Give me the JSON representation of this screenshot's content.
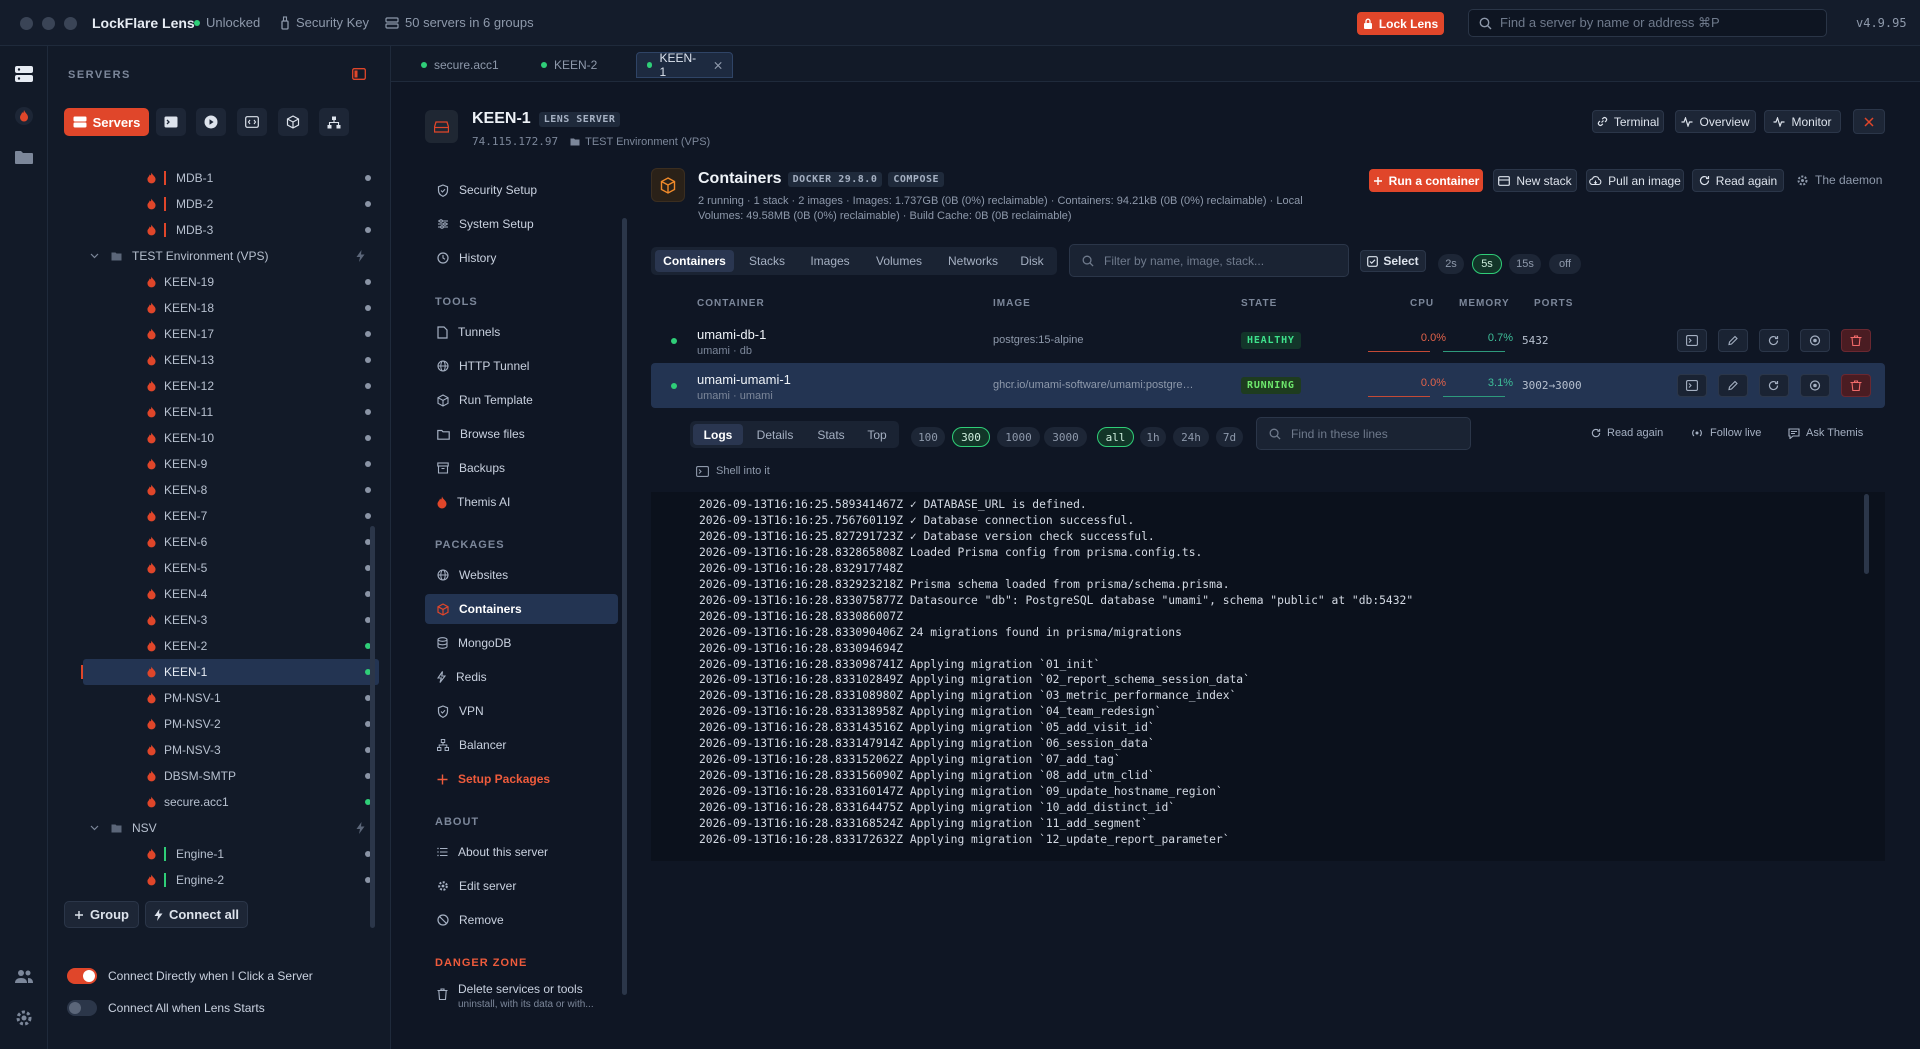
{
  "titlebar": {
    "app_title": "LockFlare Lens",
    "lock_status": "Unlocked",
    "security_key": "Security Key",
    "server_count": "50 servers in 6 groups",
    "lock_button": "Lock Lens",
    "search_placeholder": "Find a server by name or address ⌘P",
    "version": "v4.9.95"
  },
  "sidebar": {
    "heading": "SERVERS",
    "servers_tab": "Servers",
    "servers": [
      {
        "name": "MDB-1",
        "bar": "#e0462a",
        "online": false
      },
      {
        "name": "MDB-2",
        "bar": "#e0462a",
        "online": false
      },
      {
        "name": "MDB-3",
        "bar": "#e0462a",
        "online": false
      },
      {
        "name": "KEEN-19",
        "online": false
      },
      {
        "name": "KEEN-18",
        "online": false
      },
      {
        "name": "KEEN-17",
        "online": false
      },
      {
        "name": "KEEN-13",
        "online": false
      },
      {
        "name": "KEEN-12",
        "online": false
      },
      {
        "name": "KEEN-11",
        "online": false
      },
      {
        "name": "KEEN-10",
        "online": false
      },
      {
        "name": "KEEN-9",
        "online": false
      },
      {
        "name": "KEEN-8",
        "online": false
      },
      {
        "name": "KEEN-7",
        "online": false
      },
      {
        "name": "KEEN-6",
        "online": false
      },
      {
        "name": "KEEN-5",
        "online": false
      },
      {
        "name": "KEEN-4",
        "online": false
      },
      {
        "name": "KEEN-3",
        "online": false
      },
      {
        "name": "KEEN-2",
        "online": true
      },
      {
        "name": "KEEN-1",
        "online": true
      },
      {
        "name": "PM-NSV-1",
        "online": false
      },
      {
        "name": "PM-NSV-2",
        "online": false
      },
      {
        "name": "PM-NSV-3",
        "online": false
      },
      {
        "name": "DBSM-SMTP",
        "online": false
      },
      {
        "name": "secure.acc1",
        "online": true
      },
      {
        "name": "Engine-1",
        "bar": "#2fce78",
        "online": false
      },
      {
        "name": "Engine-2",
        "bar": "#2fce78",
        "online": false
      }
    ],
    "groups": [
      {
        "name": "TEST Environment (VPS)"
      },
      {
        "name": "NSV"
      }
    ],
    "group_button": "Group",
    "connect_all_button": "Connect all",
    "toggle_connect_direct": "Connect Directly when I Click a Server",
    "toggle_connect_all": "Connect All when Lens Starts"
  },
  "tabs": [
    {
      "label": "secure.acc1"
    },
    {
      "label": "KEEN-2"
    },
    {
      "label": "KEEN-1"
    }
  ],
  "server": {
    "name": "KEEN-1",
    "badge": "LENS SERVER",
    "ip": "74.115.172.97",
    "environment": "TEST Environment (VPS)",
    "terminal": "Terminal",
    "overview": "Overview",
    "monitor": "Monitor"
  },
  "nav": {
    "items_top": [
      "Security Setup",
      "System Setup",
      "History"
    ],
    "tools_heading": "TOOLS",
    "tools": [
      "Tunnels",
      "HTTP Tunnel",
      "Run Template",
      "Browse files",
      "Backups",
      "Themis AI"
    ],
    "packages_heading": "PACKAGES",
    "packages": [
      "Websites",
      "Containers",
      "MongoDB",
      "Redis",
      "VPN",
      "Balancer",
      "Setup Packages"
    ],
    "about_heading": "ABOUT",
    "about": [
      "About this server",
      "Edit server",
      "Remove"
    ],
    "danger_heading": "DANGER ZONE",
    "danger_title": "Delete services or tools",
    "danger_sub": "uninstall, with its data or with..."
  },
  "containers": {
    "title": "Containers",
    "docker_badge": "DOCKER 29.8.0",
    "compose_badge": "COMPOSE",
    "summary": "2 running · 1 stack · 2 images · Images: 1.737GB (0B (0%) reclaimable) · Containers: 94.21kB (0B (0%) reclaimable) · Local Volumes: 49.58MB (0B (0%) reclaimable) · Build Cache: 0B (0B reclaimable)",
    "run_button": "Run a container",
    "new_stack": "New stack",
    "pull_image": "Pull an image",
    "read_again": "Read again",
    "daemon": "The daemon",
    "tabs": [
      "Containers",
      "Stacks",
      "Images",
      "Volumes",
      "Networks",
      "Disk"
    ],
    "filter_placeholder": "Filter by name, image, stack...",
    "select_button": "Select",
    "refresh_options": [
      "2s",
      "5s",
      "15s",
      "off"
    ],
    "columns": {
      "container": "CONTAINER",
      "image": "IMAGE",
      "state": "STATE",
      "cpu": "CPU",
      "memory": "MEMORY",
      "ports": "PORTS"
    },
    "rows": [
      {
        "name": "umami-db-1",
        "sub": "umami · db",
        "image": "postgres:15-alpine",
        "state": "HEALTHY",
        "cpu": "0.0%",
        "cpu_frac": 0.0,
        "memory": "0.7%",
        "mem_frac": 0.007,
        "ports": "5432"
      },
      {
        "name": "umami-umami-1",
        "sub": "umami · umami",
        "image": "ghcr.io/umami-software/umami:postgresql-latest",
        "state": "RUNNING",
        "cpu": "0.0%",
        "cpu_frac": 0.0,
        "memory": "3.1%",
        "mem_frac": 0.031,
        "ports": "3002→3000"
      }
    ]
  },
  "logs": {
    "tabs": [
      "Logs",
      "Details",
      "Stats",
      "Top"
    ],
    "counts": [
      "100",
      "300",
      "1000",
      "3000"
    ],
    "ranges": [
      "all",
      "1h",
      "24h",
      "7d"
    ],
    "search_placeholder": "Find in these lines",
    "read_again": "Read again",
    "follow_live": "Follow live",
    "ask_themis": "Ask Themis",
    "shell": "Shell into it",
    "lines": [
      "2026-09-13T16:16:25.589341467Z ✓ DATABASE_URL is defined.",
      "2026-09-13T16:16:25.756760119Z ✓ Database connection successful.",
      "2026-09-13T16:16:25.827291723Z ✓ Database version check successful.",
      "2026-09-13T16:16:28.832865808Z Loaded Prisma config from prisma.config.ts.",
      "2026-09-13T16:16:28.832917748Z",
      "2026-09-13T16:16:28.832923218Z Prisma schema loaded from prisma/schema.prisma.",
      "2026-09-13T16:16:28.833075877Z Datasource \"db\": PostgreSQL database \"umami\", schema \"public\" at \"db:5432\"",
      "2026-09-13T16:16:28.833086007Z",
      "2026-09-13T16:16:28.833090406Z 24 migrations found in prisma/migrations",
      "2026-09-13T16:16:28.833094694Z",
      "2026-09-13T16:16:28.833098741Z Applying migration `01_init`",
      "2026-09-13T16:16:28.833102849Z Applying migration `02_report_schema_session_data`",
      "2026-09-13T16:16:28.833108980Z Applying migration `03_metric_performance_index`",
      "2026-09-13T16:16:28.833138958Z Applying migration `04_team_redesign`",
      "2026-09-13T16:16:28.833143516Z Applying migration `05_add_visit_id`",
      "2026-09-13T16:16:28.833147914Z Applying migration `06_session_data`",
      "2026-09-13T16:16:28.833152062Z Applying migration `07_add_tag`",
      "2026-09-13T16:16:28.833156090Z Applying migration `08_add_utm_clid`",
      "2026-09-13T16:16:28.833160147Z Applying migration `09_update_hostname_region`",
      "2026-09-13T16:16:28.833164475Z Applying migration `10_add_distinct_id`",
      "2026-09-13T16:16:28.833168524Z Applying migration `11_add_segment`",
      "2026-09-13T16:16:28.833172632Z Applying migration `12_update_report_parameter`"
    ]
  },
  "colors": {
    "accent": "#e0462a",
    "online": "#2fce78",
    "selected": "#233452"
  }
}
